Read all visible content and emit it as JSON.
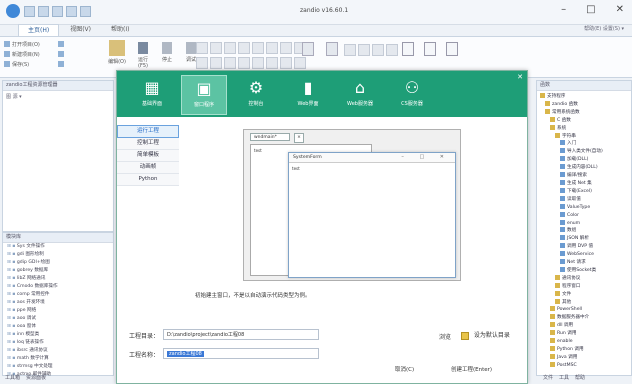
{
  "window": {
    "title": "zandio v16.60.1",
    "controls": [
      "–",
      "□",
      "✕"
    ]
  },
  "ribbon": {
    "tabs": [
      "主页(H)",
      "视图(V)",
      "帮助(I)"
    ],
    "right_text": "帮助(E)  设置(S) ▾",
    "group1": [
      "打开项目(O)",
      "新建项目(N)",
      "保存(S)"
    ],
    "group2": [
      "运行(F5)",
      "停止",
      "调试"
    ],
    "big_label": "编辑(O)"
  },
  "left_top_panel": {
    "title": "zandio工程资源管理器",
    "toolbar": "图 源 ▾"
  },
  "left_bottom_panel": {
    "title": "模块库",
    "items": [
      "Sys 文件操作",
      "gdi 图形绘制",
      "gdip GDI+绘图",
      "gobrey 数据库",
      "libZ 网络通讯",
      "Cmodo 数据库操作",
      "comp 常用控件",
      "aos 开发环境",
      "ppe 网络",
      "aoo 调试",
      "ooa 窗体",
      "inn 模型类",
      "loq 链表操作",
      "ibsrc 通讯协议",
      "math 数学计算",
      "strmsg 中文处理",
      "actrxo 邮件辅助"
    ],
    "status_tabs": [
      "工具箱",
      "资源面板"
    ]
  },
  "dialog": {
    "toolbar": [
      {
        "icon": "table-icon",
        "label": "基础界面"
      },
      {
        "icon": "window-icon",
        "label": "窗口程序"
      },
      {
        "icon": "gears-icon",
        "label": "控制台"
      },
      {
        "icon": "bar-chart-icon",
        "label": "Web界面"
      },
      {
        "icon": "home-icon",
        "label": "Web服务器"
      },
      {
        "icon": "network-icon",
        "label": "CS服务器"
      }
    ],
    "side_menu": [
      "运行工程",
      "控制工程",
      "简单模板",
      "动画帧",
      "Python"
    ],
    "preview": {
      "back_tab": "wndmain*",
      "back_tab_x": "×",
      "back_text": "test",
      "front_title": "SystemForm",
      "front_controls": "– □ ✕",
      "front_text": "test"
    },
    "note": "初始建主窗口，不是以自动演示代码类型为例。",
    "project_dir_label": "工程目录：",
    "project_dir_value": "D:\\zandio\\project\\zandio工程08",
    "browse_label": "浏览",
    "default_dir_label": "设为默认目录",
    "project_name_label": "工程名称：",
    "project_name_value": "zandio工程08",
    "cancel_label": "取消(C)",
    "create_label": "创建工程(Enter)"
  },
  "right_panel": {
    "title": "函数",
    "items": [
      {
        "indent": 0,
        "label": "支持程序",
        "icon": "folder"
      },
      {
        "indent": 1,
        "label": "zandio 函数",
        "icon": "folder"
      },
      {
        "indent": 1,
        "label": "常用系统函数",
        "icon": "folder"
      },
      {
        "indent": 2,
        "label": "C 函数",
        "icon": "folder"
      },
      {
        "indent": 2,
        "label": "系统",
        "icon": "folder"
      },
      {
        "indent": 3,
        "label": "字符串",
        "icon": "folder"
      },
      {
        "indent": 4,
        "label": "入门",
        "icon": "item"
      },
      {
        "indent": 4,
        "label": "导入类文件(自动)",
        "icon": "item"
      },
      {
        "indent": 4,
        "label": "加载(DLL)",
        "icon": "item"
      },
      {
        "indent": 4,
        "label": "生成内容(DLL)",
        "icon": "item"
      },
      {
        "indent": 4,
        "label": "编译/搜索",
        "icon": "item"
      },
      {
        "indent": 4,
        "label": "生成 Net 集",
        "icon": "item"
      },
      {
        "indent": 4,
        "label": "下载(Excel)",
        "icon": "item"
      },
      {
        "indent": 4,
        "label": "读取值",
        "icon": "item"
      },
      {
        "indent": 4,
        "label": "ValueType",
        "icon": "item"
      },
      {
        "indent": 4,
        "label": "Color",
        "icon": "item"
      },
      {
        "indent": 4,
        "label": "enum",
        "icon": "item"
      },
      {
        "indent": 4,
        "label": "数组",
        "icon": "item"
      },
      {
        "indent": 4,
        "label": "JSON 解析",
        "icon": "item"
      },
      {
        "indent": 4,
        "label": "调用 DVP 值",
        "icon": "item"
      },
      {
        "indent": 4,
        "label": "WebService",
        "icon": "item"
      },
      {
        "indent": 4,
        "label": "Net 请求",
        "icon": "item"
      },
      {
        "indent": 4,
        "label": "使用Socket类",
        "icon": "item"
      },
      {
        "indent": 3,
        "label": "通讯协议",
        "icon": "folder"
      },
      {
        "indent": 3,
        "label": "程序窗口",
        "icon": "folder"
      },
      {
        "indent": 3,
        "label": "文件",
        "icon": "folder"
      },
      {
        "indent": 3,
        "label": "其他",
        "icon": "folder"
      },
      {
        "indent": 2,
        "label": "PowerShell",
        "icon": "folder"
      },
      {
        "indent": 2,
        "label": "数据服务器中介",
        "icon": "folder"
      },
      {
        "indent": 2,
        "label": "dll 调用",
        "icon": "folder"
      },
      {
        "indent": 2,
        "label": "Run 调用",
        "icon": "folder"
      },
      {
        "indent": 2,
        "label": "enable",
        "icon": "folder"
      },
      {
        "indent": 2,
        "label": "Python 调用",
        "icon": "folder"
      },
      {
        "indent": 2,
        "label": "Java 调用",
        "icon": "folder"
      },
      {
        "indent": 2,
        "label": "PostMSC",
        "icon": "folder"
      }
    ],
    "status_tabs": [
      "文件",
      "工具",
      "帮助"
    ]
  }
}
